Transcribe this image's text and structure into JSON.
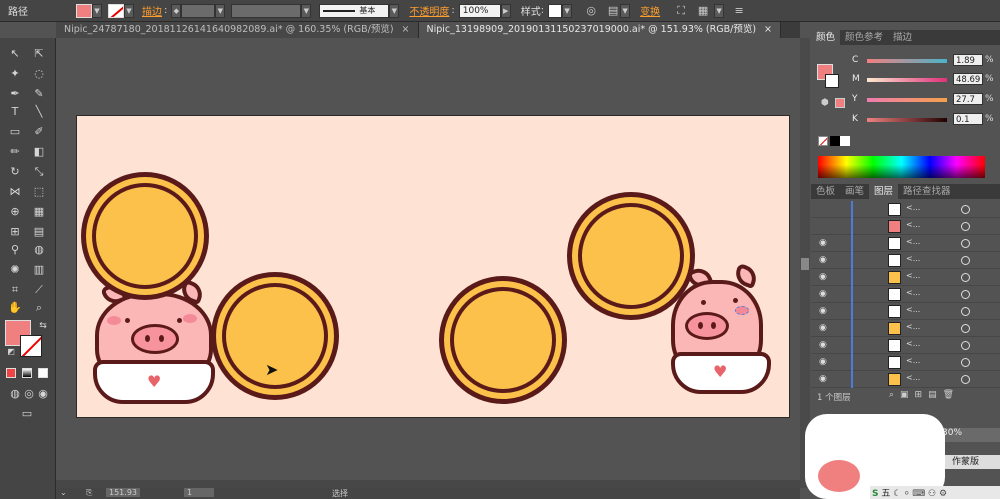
{
  "topbar": {
    "object_type": "路径",
    "stroke_label": "描边",
    "stroke_weight": "",
    "brush_label": "基本",
    "opacity_label": "不透明度",
    "opacity_value": "100%",
    "style_label": "样式",
    "transform_label": "变换"
  },
  "tabs": [
    {
      "label": "Nipic_24787180_20181126141640982089.ai* @ 160.35% (RGB/预览)",
      "active": false
    },
    {
      "label": "Nipic_13198909_20190131150237019000.ai* @ 151.93% (RGB/预览)",
      "active": true
    }
  ],
  "color_panel": {
    "tabs": [
      "颜色",
      "颜色参考",
      "描边"
    ],
    "channels": [
      {
        "key": "C",
        "value": "1.89",
        "unit": "%"
      },
      {
        "key": "M",
        "value": "48.69",
        "unit": "%"
      },
      {
        "key": "Y",
        "value": "27.7",
        "unit": "%"
      },
      {
        "key": "K",
        "value": "0.1",
        "unit": "%"
      }
    ],
    "fill_color": "#f08080"
  },
  "layers_panel": {
    "tabs": [
      "色板",
      "画笔",
      "图层",
      "路径查找器"
    ],
    "rows": [
      {
        "thumb": "white",
        "name": "<..."
      },
      {
        "thumb": "pink",
        "name": "<..."
      },
      {
        "thumb": "white",
        "name": "<..."
      },
      {
        "thumb": "white",
        "name": "<..."
      },
      {
        "thumb": "yellow",
        "name": "<..."
      },
      {
        "thumb": "white",
        "name": "<..."
      },
      {
        "thumb": "white",
        "name": "<..."
      },
      {
        "thumb": "yellow",
        "name": "<..."
      },
      {
        "thumb": "white",
        "name": "<..."
      },
      {
        "thumb": "white",
        "name": "<..."
      },
      {
        "thumb": "yellow",
        "name": "<..."
      }
    ],
    "footer": "1 个图层",
    "overlay_text": "作蒙版",
    "percent": "30%"
  },
  "status": {
    "zoom": "151.93",
    "page": "1",
    "tool_name": "选择"
  },
  "ime": {
    "label": "五"
  }
}
